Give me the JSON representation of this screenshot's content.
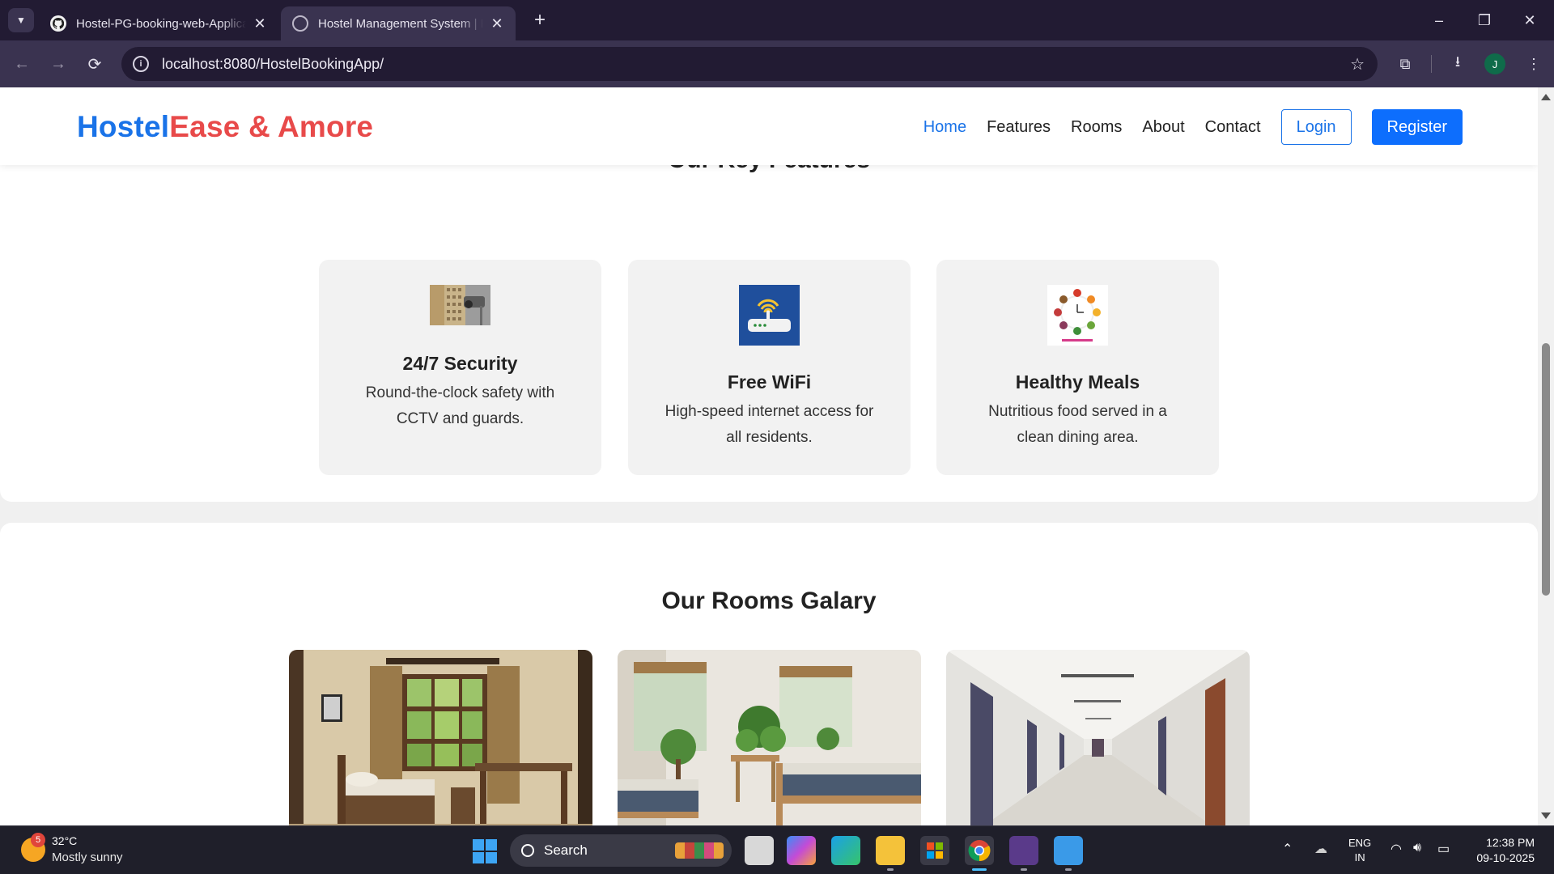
{
  "browser": {
    "tabs": [
      {
        "title": "Hostel-PG-booking-web-Application",
        "active": false
      },
      {
        "title": "Hostel Management System | HostelEase",
        "active": true
      }
    ],
    "new_tab_symbol": "+",
    "close_symbol": "✕",
    "url": "localhost:8080/HostelBookingApp/",
    "profile_initial": "J",
    "window_controls": {
      "minimize": "–",
      "restore": "❐",
      "close": "✕"
    }
  },
  "site": {
    "logo": {
      "part1": "Hostel",
      "part2": "Ease & Amore"
    },
    "nav": [
      {
        "label": "Home",
        "active": true
      },
      {
        "label": "Features",
        "active": false
      },
      {
        "label": "Rooms",
        "active": false
      },
      {
        "label": "About",
        "active": false
      },
      {
        "label": "Contact",
        "active": false
      }
    ],
    "login_label": "Login",
    "register_label": "Register"
  },
  "features": {
    "title": "Our Key Features",
    "cards": [
      {
        "title": "24/7 Security",
        "description": "Round-the-clock safety with CCTV and guards.",
        "icon": "cctv-camera-icon"
      },
      {
        "title": "Free WiFi",
        "description": "High-speed internet access for all residents.",
        "icon": "wifi-router-icon"
      },
      {
        "title": "Healthy Meals",
        "description": "Nutritious food served in a clean dining area.",
        "icon": "healthy-food-clock-icon"
      }
    ]
  },
  "rooms": {
    "title": "Our Rooms Galary",
    "images": [
      {
        "name": "single-room-photo"
      },
      {
        "name": "shared-room-photo"
      },
      {
        "name": "corridor-photo"
      }
    ]
  },
  "taskbar": {
    "weather": {
      "temp": "32°C",
      "desc": "Mostly sunny",
      "badge": "5"
    },
    "search_label": "Search",
    "language": {
      "line1": "ENG",
      "line2": "IN"
    },
    "time": "12:38 PM",
    "date": "09-10-2025"
  },
  "colors": {
    "primary": "#1a73e8",
    "accent_red": "#e84a4a",
    "register_bg": "#0d6efd",
    "browser_dark": "#221b33",
    "browser_toolbar": "#3a3350",
    "card_bg": "#f2f2f2"
  }
}
